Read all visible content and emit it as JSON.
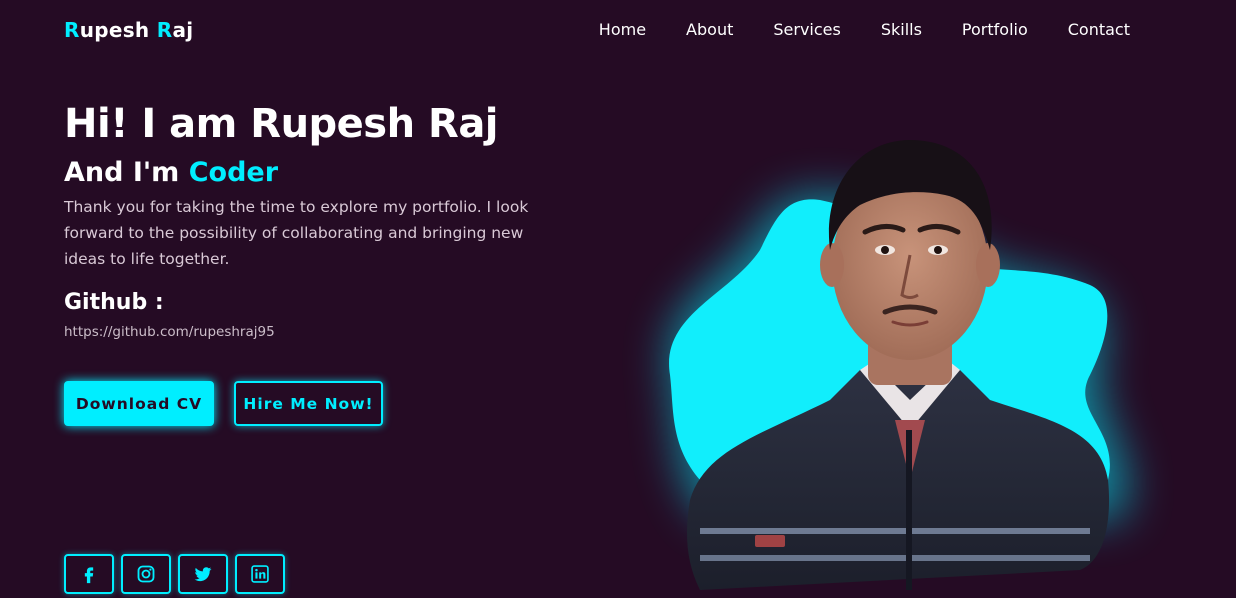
{
  "header": {
    "logo_first": "R",
    "logo_rest1": "upesh ",
    "logo_accent2": "R",
    "logo_rest2": "aj",
    "nav": [
      "Home",
      "About",
      "Services",
      "Skills",
      "Portfolio",
      "Contact"
    ]
  },
  "hero": {
    "title": "Hi! I am Rupesh Raj",
    "sub_prefix": "And I'm ",
    "role": "Coder",
    "description": "Thank you for taking the time to explore my portfolio. I look forward to the possibility of collaborating and bringing new ideas to life together.",
    "github_label": "Github :",
    "github_url": "https://github.com/rupeshraj95"
  },
  "buttons": {
    "download": "Download CV",
    "hire": "Hire Me Now!"
  },
  "socials": [
    "facebook-icon",
    "instagram-icon",
    "twitter-icon",
    "linkedin-icon"
  ],
  "colors": {
    "background": "#250b24",
    "accent": "#00eeff",
    "text": "#ffffff"
  }
}
